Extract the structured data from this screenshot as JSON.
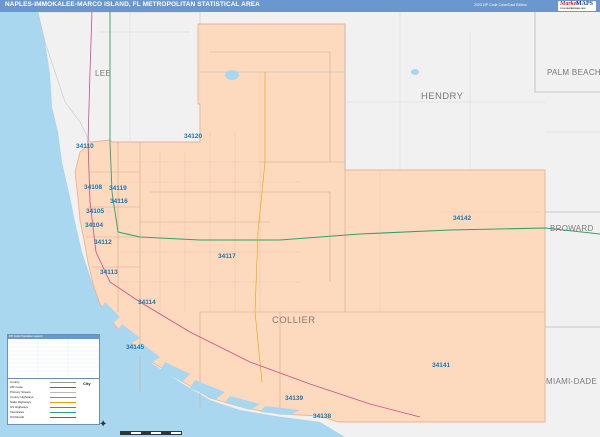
{
  "header": {
    "title": "NAPLES-IMMOKALEE-MARCO ISLAND, FL METROPOLITAN STATISTICAL AREA",
    "edition": "2023 ZIP Code Color/Cast Edition",
    "logo_main": "Market",
    "logo_accent": "MAPS",
    "logo_sub": "www.marketmaps.com"
  },
  "colors": {
    "title_bar": "#6b97cf",
    "collier_fill": "#fdd9be",
    "collier_border": "#eab494",
    "neighbor_fill": "#f1f1f1",
    "water": "#a9d7f0",
    "zip_label": "#1778b8",
    "interstate": "#2fa26b",
    "us_highway": "#c94d8b"
  },
  "counties": {
    "lee": "LEE",
    "hendry": "HENDRY",
    "palm_beach": "PALM BEACH",
    "broward": "BROWARD",
    "collier": "COLLIER",
    "miami_dade": "MIAMI-DADE"
  },
  "zip_codes": [
    {
      "code": "34110"
    },
    {
      "code": "34120"
    },
    {
      "code": "34108"
    },
    {
      "code": "34119"
    },
    {
      "code": "34116"
    },
    {
      "code": "34105"
    },
    {
      "code": "34104"
    },
    {
      "code": "34112"
    },
    {
      "code": "34117"
    },
    {
      "code": "34142"
    },
    {
      "code": "34113"
    },
    {
      "code": "34114"
    },
    {
      "code": "34141"
    },
    {
      "code": "34145"
    },
    {
      "code": "34139"
    },
    {
      "code": "34138"
    }
  ],
  "legend": {
    "table_title": "ZIP Code Population Legend",
    "key_items": [
      {
        "label": "County",
        "color": "#999999"
      },
      {
        "label": "ZIP Code",
        "color": "#1778b8"
      },
      {
        "label": "Primary Streets",
        "color": "#bbbbbb"
      },
      {
        "label": "County Highways",
        "color": "#888888"
      },
      {
        "label": "State Highways",
        "color": "#e0a400"
      },
      {
        "label": "US Highways",
        "color": "#c94d8b"
      },
      {
        "label": "Interstates",
        "color": "#2fa26b"
      },
      {
        "label": "Toll Roads",
        "color": "#6a4fb3"
      }
    ],
    "city_label": "City"
  }
}
